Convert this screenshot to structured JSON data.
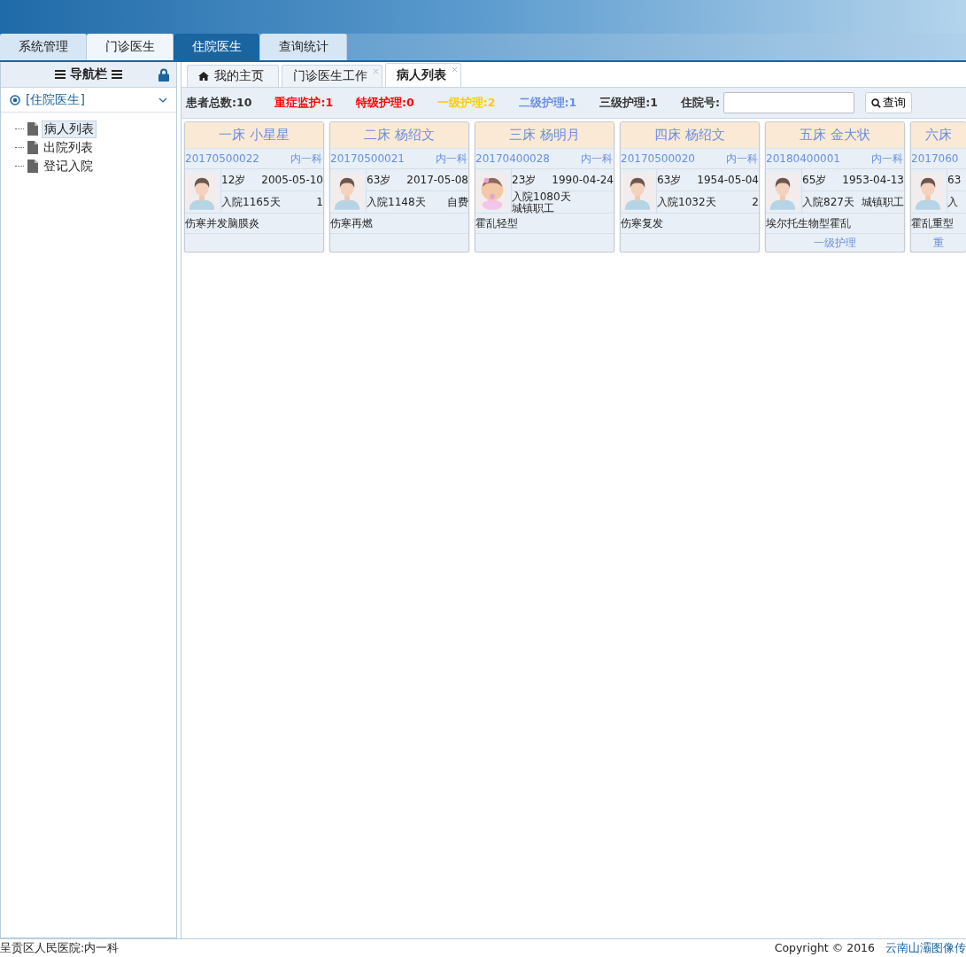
{
  "top_tabs": [
    {
      "label": "系统管理",
      "selected": false
    },
    {
      "label": "门诊医生",
      "selected": false
    },
    {
      "label": "住院医生",
      "selected": true
    },
    {
      "label": "查询统计",
      "selected": false
    }
  ],
  "sidebar": {
    "title": "导航栏",
    "section": "[住院医生]",
    "items": [
      {
        "label": "病人列表",
        "selected": true
      },
      {
        "label": "出院列表",
        "selected": false
      },
      {
        "label": "登记入院",
        "selected": false
      }
    ]
  },
  "page_tabs": [
    {
      "label": "我的主页",
      "kind": "home",
      "selected": false
    },
    {
      "label": "门诊医生工作",
      "kind": "closable",
      "selected": false
    },
    {
      "label": "病人列表",
      "kind": "closable",
      "selected": true
    }
  ],
  "stats": [
    {
      "text": "患者总数:10",
      "color": "#333333"
    },
    {
      "text": "重症监护:1",
      "color": "#ff0000"
    },
    {
      "text": "特级护理:0",
      "color": "#ff0000"
    },
    {
      "text": "一级护理:2",
      "color": "#ffcc00"
    },
    {
      "text": "二级护理:1",
      "color": "#6a8fe0"
    },
    {
      "text": "三级护理:1",
      "color": "#333333"
    }
  ],
  "search": {
    "label": "住院号:",
    "button": "查询"
  },
  "patients": [
    {
      "title": "一床 小星星",
      "id": "20170500022",
      "dept": "内一科",
      "kind": "adult",
      "age": "12岁",
      "birth": "2005-05-10",
      "days": "入院1165天",
      "payer": "1",
      "diagnosis": "伤寒并发脑膜炎"
    },
    {
      "title": "二床 杨绍文",
      "id": "20170500021",
      "dept": "内一科",
      "kind": "adult",
      "age": "63岁",
      "birth": "2017-05-08",
      "days": "入院1148天",
      "payer": "自费",
      "diagnosis": "伤寒再燃"
    },
    {
      "title": "三床 杨明月",
      "id": "20170400028",
      "dept": "内一科",
      "kind": "baby",
      "age": "23岁",
      "birth": "1990-04-24",
      "days": "入院1080天",
      "payer": "城镇职工",
      "diagnosis": "霍乱轻型"
    },
    {
      "title": "四床 杨绍文",
      "id": "20170500020",
      "dept": "内一科",
      "kind": "adult",
      "age": "63岁",
      "birth": "1954-05-04",
      "days": "入院1032天",
      "payer": "2",
      "diagnosis": "伤寒复发"
    },
    {
      "title": "五床 金大状",
      "id": "20180400001",
      "dept": "内一科",
      "kind": "adult",
      "age": "65岁",
      "birth": "1953-04-13",
      "days": "入院827天",
      "payer": "城镇职工",
      "diagnosis": "埃尔托生物型霍乱",
      "nursing": "一级护理"
    },
    {
      "title": "六床",
      "id": "2017060",
      "kind": "adult",
      "age": "63",
      "days": "入",
      "diagnosis": "霍乱重型",
      "nursing": "重"
    }
  ],
  "footer": {
    "left": "呈贡区人民医院:内一科",
    "copyright": "Copyright © 2016",
    "company": "云南山灞图像传"
  }
}
